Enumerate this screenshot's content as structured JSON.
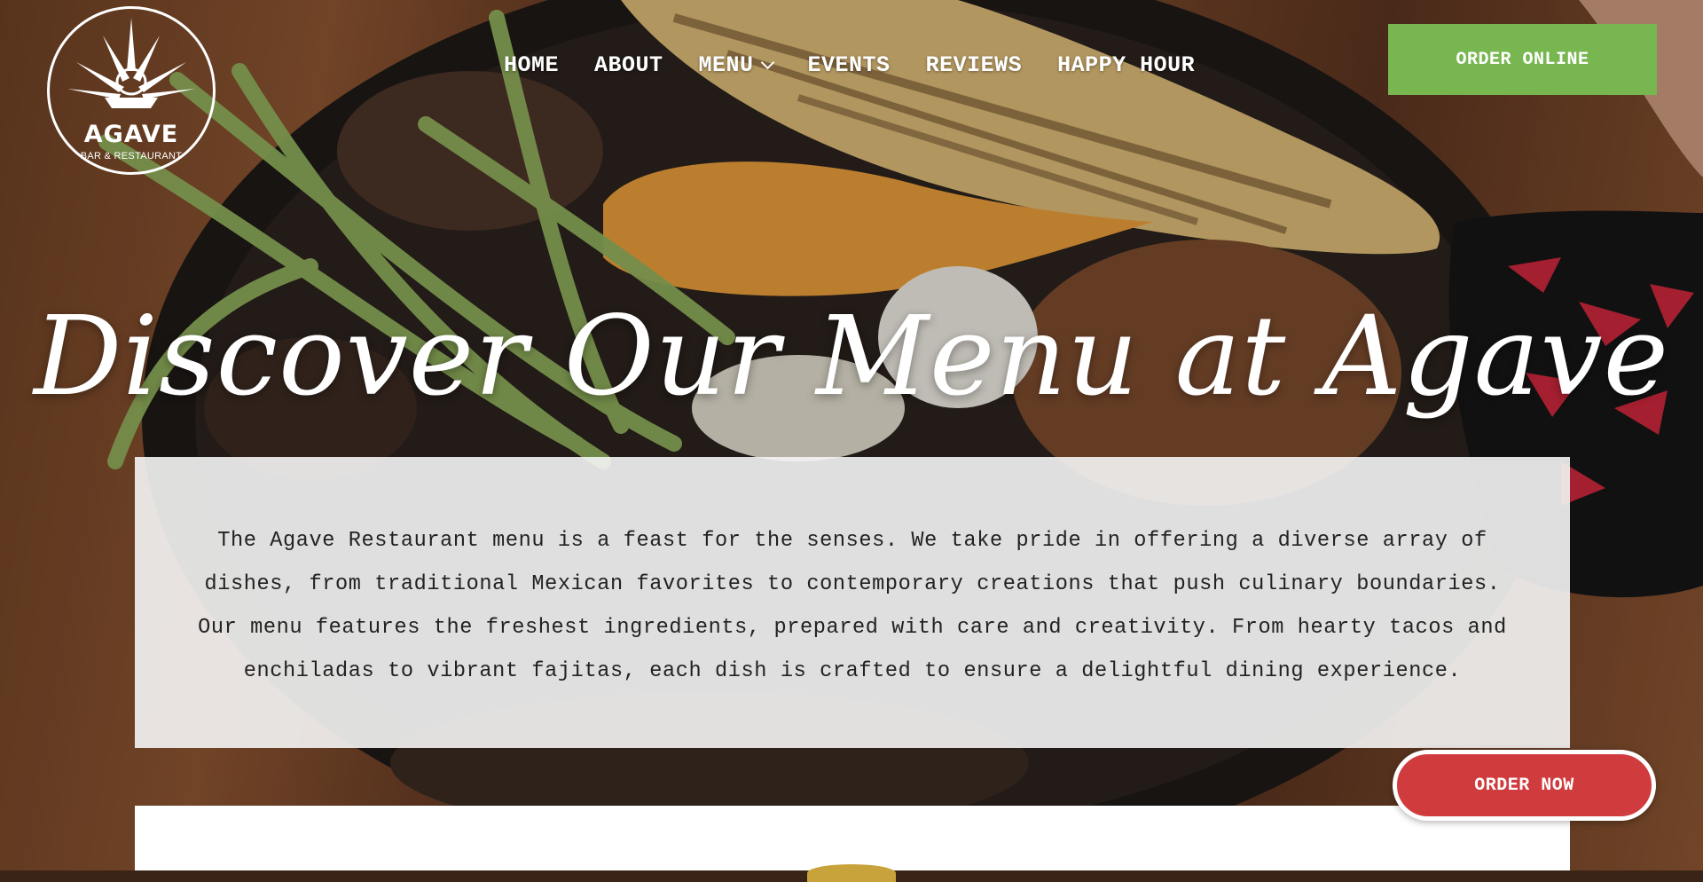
{
  "logo": {
    "name": "AGAVE",
    "subtitle": "BAR & RESTAURANT"
  },
  "nav": {
    "items": [
      {
        "label": "HOME"
      },
      {
        "label": "ABOUT"
      },
      {
        "label": "MENU",
        "has_dropdown": true
      },
      {
        "label": "EVENTS"
      },
      {
        "label": "REVIEWS"
      },
      {
        "label": "HAPPY HOUR"
      }
    ]
  },
  "header": {
    "order_online_label": "ORDER ONLINE"
  },
  "hero": {
    "title": "Discover Our Menu at Agave",
    "intro": "The Agave Restaurant menu is a feast for the senses. We take pride in offering a diverse array of dishes, from traditional Mexican favorites to contemporary creations that push culinary boundaries. Our menu features the freshest ingredients, prepared with care and creativity. From hearty tacos and enchiladas to vibrant fajitas, each dish is crafted to ensure a delightful dining experience."
  },
  "floating": {
    "order_now_label": "ORDER NOW"
  },
  "colors": {
    "order_online_bg": "#78b650",
    "order_now_bg": "#d03b3e",
    "panel_bg": "#f5f5f5"
  }
}
